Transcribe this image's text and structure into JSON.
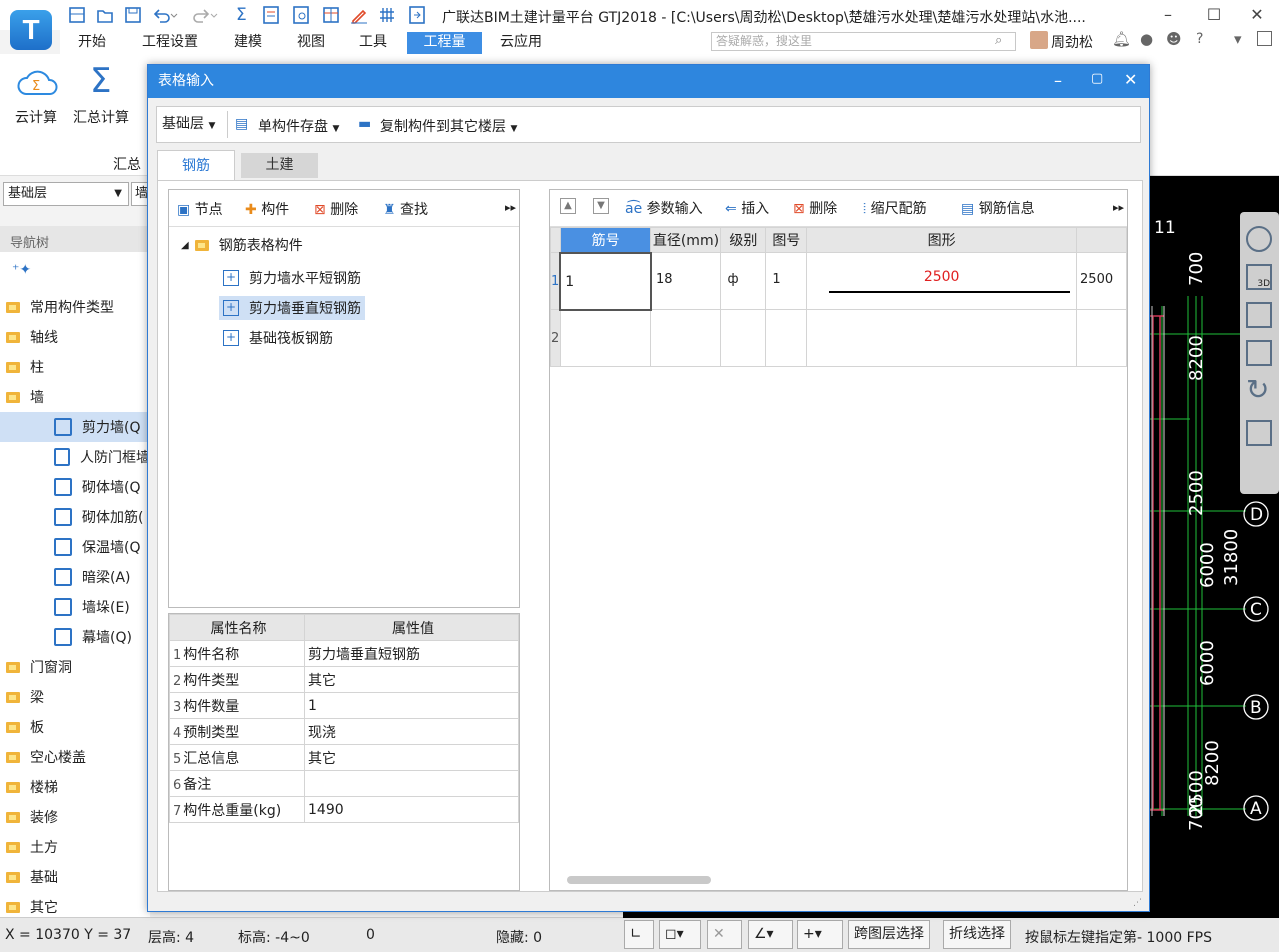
{
  "window": {
    "title": "广联达BIM土建计量平台 GTJ2018 - [C:\\Users\\周劲松\\Desktop\\楚雄污水处理\\楚雄污水处理站\\水池....",
    "user": "周劲松",
    "search_placeholder": "答疑解惑，搜这里"
  },
  "menus": [
    "开始",
    "工程设置",
    "建模",
    "视图",
    "工具",
    "工程量",
    "云应用"
  ],
  "ribbon": {
    "cloud_calc": "云计算",
    "sum_calc": "汇总计算",
    "group_label": "汇总"
  },
  "left": {
    "layer": "基础层",
    "layer2": "墙",
    "nav_header": "导航树",
    "items": [
      {
        "label": "常用构件类型",
        "level": 0
      },
      {
        "label": "轴线",
        "level": 0
      },
      {
        "label": "柱",
        "level": 0
      },
      {
        "label": "墙",
        "level": 0
      },
      {
        "label": "剪力墙(Q",
        "level": 1
      },
      {
        "label": "人防门框墙",
        "level": 1
      },
      {
        "label": "砌体墙(Q",
        "level": 1
      },
      {
        "label": "砌体加筋(",
        "level": 1
      },
      {
        "label": "保温墙(Q",
        "level": 1
      },
      {
        "label": "暗梁(A)",
        "level": 1
      },
      {
        "label": "墙垛(E)",
        "level": 1
      },
      {
        "label": "幕墙(Q)",
        "level": 1
      },
      {
        "label": "门窗洞",
        "level": 0
      },
      {
        "label": "梁",
        "level": 0
      },
      {
        "label": "板",
        "level": 0
      },
      {
        "label": "空心楼盖",
        "level": 0
      },
      {
        "label": "楼梯",
        "level": 0
      },
      {
        "label": "装修",
        "level": 0
      },
      {
        "label": "土方",
        "level": 0
      },
      {
        "label": "基础",
        "level": 0
      },
      {
        "label": "其它",
        "level": 0
      }
    ]
  },
  "canvas": {
    "axis_labels": [
      "11",
      "D",
      "C",
      "B",
      "A"
    ],
    "dims": [
      "31800",
      "6000",
      "6000",
      "700",
      "2500",
      "8200",
      "700",
      "8200",
      "2500"
    ]
  },
  "status": {
    "coords": "X = 10370 Y = 37",
    "floor_height": "层高:  4",
    "elevation": "标高:  -4~0",
    "zero": "0",
    "hidden": "隐藏:  0",
    "btn_cross_layer": "跨图层选择",
    "btn_polyline": "折线选择",
    "hint": "按鼠标左键指定第- 1000 FPS"
  },
  "dialog": {
    "title": "表格输入",
    "toolbar": {
      "layer": "基础层",
      "save": "单构件存盘",
      "copy": "复制构件到其它楼层"
    },
    "tabs": [
      "钢筋",
      "土建"
    ],
    "tree_toolbar": [
      "节点",
      "构件",
      "删除",
      "查找"
    ],
    "tree": {
      "root": "钢筋表格构件",
      "children": [
        "剪力墙水平短钢筋",
        "剪力墙垂直短钢筋",
        "基础筏板钢筋"
      ],
      "selected": 1
    },
    "props": {
      "headers": [
        "属性名称",
        "属性值"
      ],
      "rows": [
        [
          "1",
          "构件名称",
          "剪力墙垂直短钢筋"
        ],
        [
          "2",
          "构件类型",
          "其它"
        ],
        [
          "3",
          "构件数量",
          "1"
        ],
        [
          "4",
          "预制类型",
          "现浇"
        ],
        [
          "5",
          "汇总信息",
          "其它"
        ],
        [
          "6",
          "备注",
          ""
        ],
        [
          "7",
          "构件总重量(kg)",
          "1490"
        ]
      ]
    },
    "grid_toolbar": [
      "参数输入",
      "插入",
      "删除",
      "缩尺配筋",
      "钢筋信息"
    ],
    "grid": {
      "headers": [
        "筋号",
        "直径(mm)",
        "级别",
        "图号",
        "图形"
      ],
      "rows": [
        {
          "n": "1",
          "bar": "1",
          "dia": "18",
          "grade": "ф",
          "fig": "1",
          "shape_len": "2500",
          "extra": "2500"
        },
        {
          "n": "2",
          "bar": "",
          "dia": "",
          "grade": "",
          "fig": "",
          "shape_len": "",
          "extra": ""
        }
      ]
    }
  }
}
